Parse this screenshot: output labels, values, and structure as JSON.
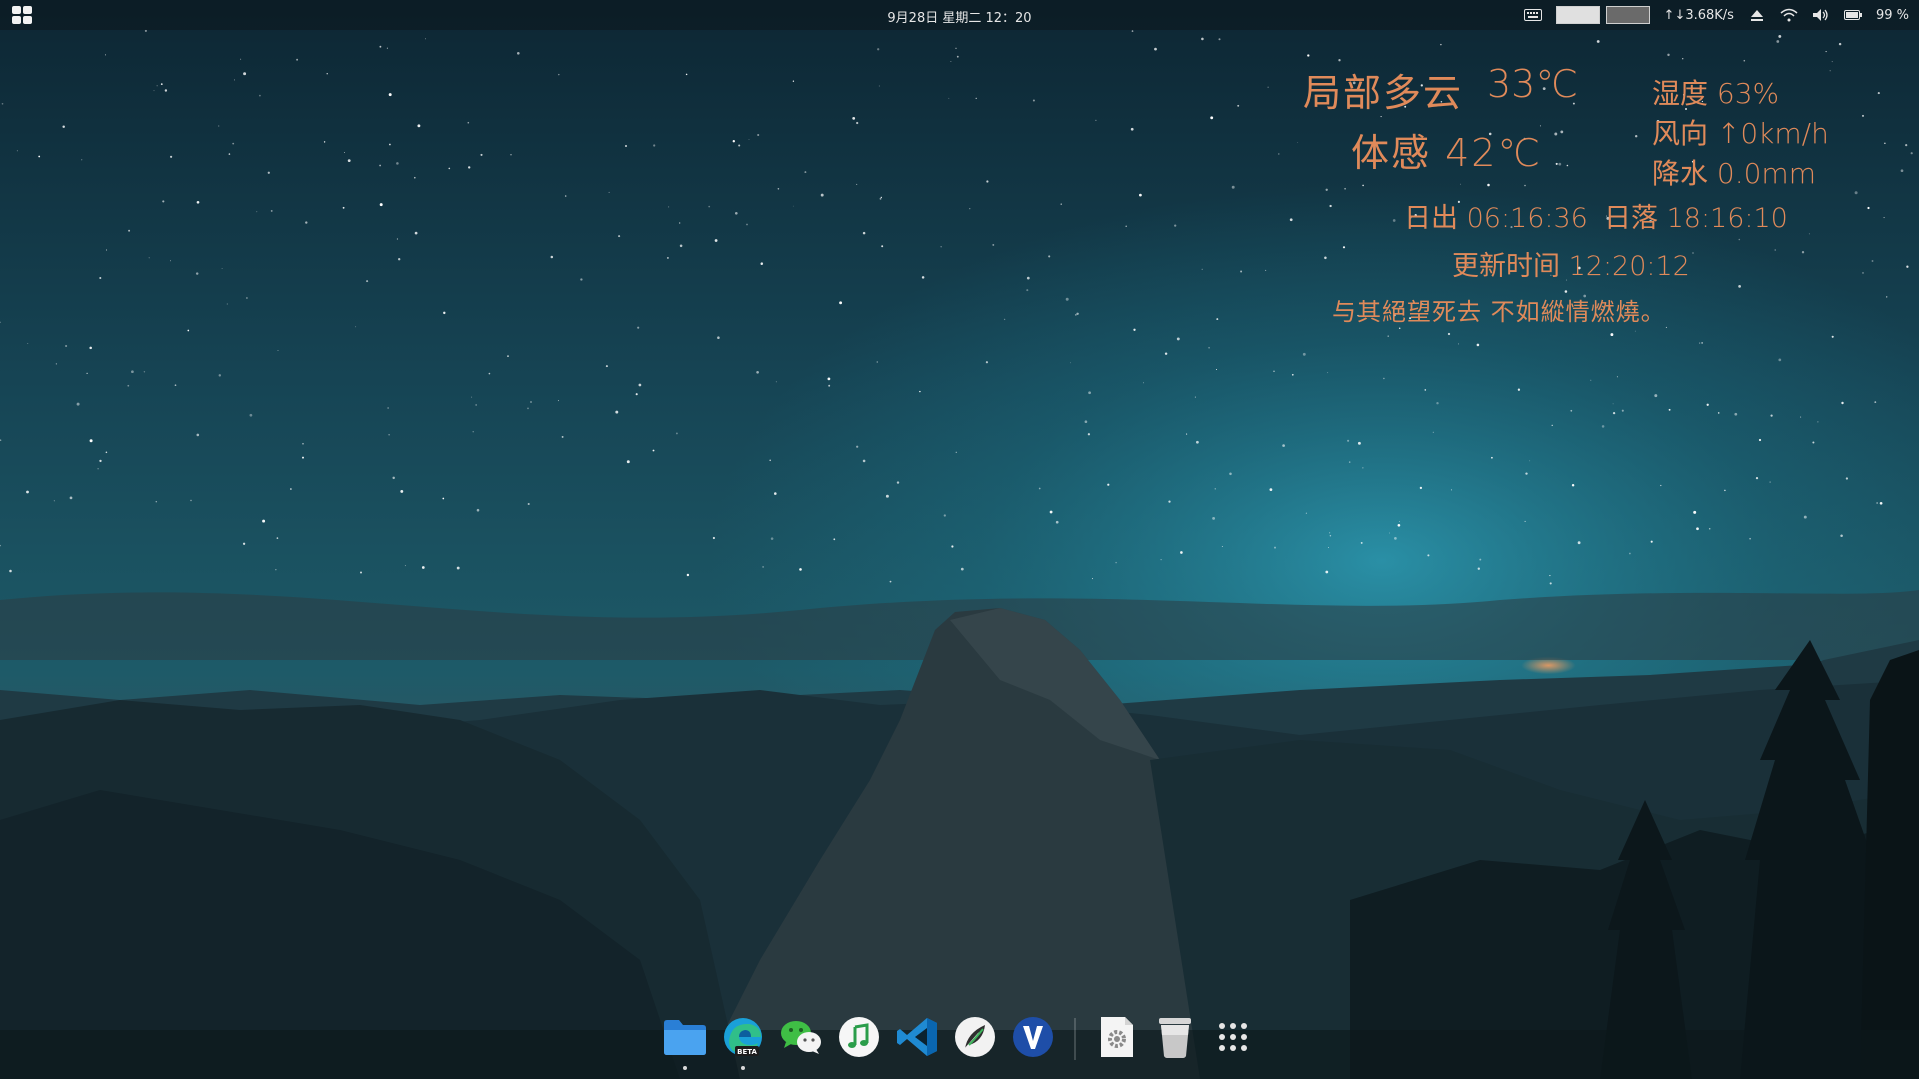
{
  "topbar": {
    "datetime": "9月28日 星期二 12：20",
    "net_speed": "↑↓3.68K/s",
    "battery_percent": "99 %"
  },
  "weather": {
    "condition": "局部多云",
    "temperature": "33℃",
    "feels_like": "体感 42℃",
    "humidity": "湿度 63%",
    "wind": "风向 ↑0km/h",
    "precipitation": "降水 0.0mm",
    "sunrise": "日出 06:16:36",
    "sunset": "日落 18:16:10",
    "update_time": "更新时间 12:20:12",
    "quote": "与其絕望死去 不如縱情燃燒。"
  },
  "dock": {
    "items": [
      {
        "name": "files",
        "icon": "folder-icon",
        "running": true
      },
      {
        "name": "edge-beta",
        "icon": "edge-beta-icon",
        "badge": "BETA",
        "running": true
      },
      {
        "name": "wechat",
        "icon": "wechat-icon",
        "running": false
      },
      {
        "name": "music",
        "icon": "music-note-icon",
        "running": false
      },
      {
        "name": "vscode",
        "icon": "vscode-icon",
        "running": false
      },
      {
        "name": "feather",
        "icon": "feather-icon",
        "running": false
      },
      {
        "name": "v-app",
        "icon": "v-icon",
        "running": false
      },
      {
        "name": "settings",
        "icon": "settings-gear-icon",
        "running": false
      },
      {
        "name": "trash",
        "icon": "trash-icon",
        "running": false
      },
      {
        "name": "app-grid",
        "icon": "app-grid-icon",
        "running": false
      }
    ]
  },
  "colors": {
    "weather_text": "#e08a5a",
    "topbar_bg": "#0c161c",
    "sky_top": "#0e2a36",
    "sky_glow": "#2c8aa0",
    "horizon_orange": "#d9875a"
  }
}
